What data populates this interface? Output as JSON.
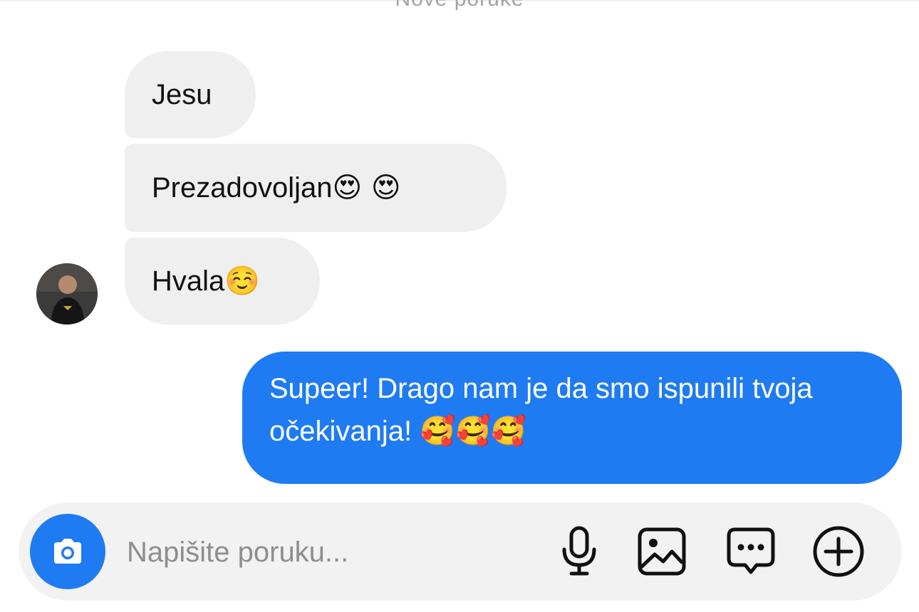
{
  "thread": {
    "header_label": "Nove poruke",
    "incoming": [
      {
        "text": "Jesu",
        "emoji": ""
      },
      {
        "text": "Prezadovoljan",
        "emoji": "😍 😍"
      },
      {
        "text": "Hvala",
        "emoji": "☺️"
      }
    ],
    "outgoing": [
      {
        "text": "Supeer! Drago nam je da smo ispunili tvoja očekivanja!",
        "emoji": "🥰🥰🥰"
      }
    ]
  },
  "composer": {
    "placeholder": "Napišite poruku...",
    "icons": [
      "camera-icon",
      "microphone-icon",
      "image-icon",
      "chat-bubble-icon",
      "plus-icon"
    ]
  },
  "colors": {
    "accent": "#1f7bf2",
    "incoming_bubble": "#efefef",
    "composer_bg": "#f2f2f2"
  }
}
